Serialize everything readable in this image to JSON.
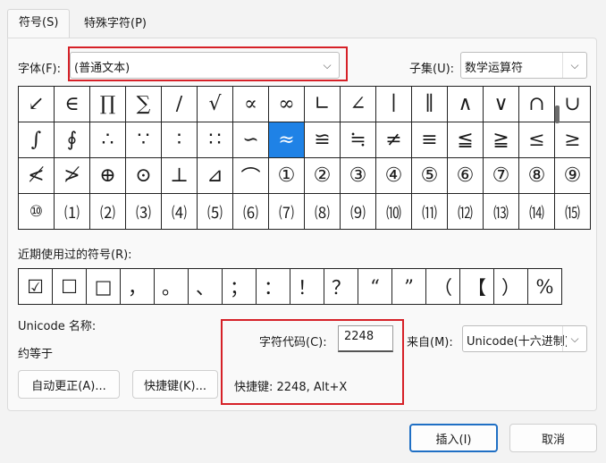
{
  "tabs": [
    {
      "label": "符号(S)"
    },
    {
      "label": "特殊字符(P)"
    }
  ],
  "font": {
    "label": "字体(F):",
    "value": "(普通文本)"
  },
  "subset": {
    "label": "子集(U):",
    "value": "数学运算符"
  },
  "symbols": [
    [
      "↙",
      "∈",
      "∏",
      "∑",
      "∕",
      "√",
      "∝",
      "∞",
      "∟",
      "∠",
      "∣",
      "∥",
      "∧",
      "∨",
      "∩",
      "∪"
    ],
    [
      "∫",
      "∮",
      "∴",
      "∵",
      "∶",
      "∷",
      "∽",
      "≈",
      "≌",
      "≒",
      "≠",
      "≡",
      "≦",
      "≧",
      "≤",
      "≥"
    ],
    [
      "≮",
      "≯",
      "⊕",
      "⊙",
      "⊥",
      "⊿",
      "⌒",
      "①",
      "②",
      "③",
      "④",
      "⑤",
      "⑥",
      "⑦",
      "⑧",
      "⑨"
    ],
    [
      "⑩",
      "⑴",
      "⑵",
      "⑶",
      "⑷",
      "⑸",
      "⑹",
      "⑺",
      "⑻",
      "⑼",
      "⑽",
      "⑾",
      "⑿",
      "⒀",
      "⒁",
      "⒂"
    ]
  ],
  "selected_symbol": "≈",
  "recent_label": "近期使用过的符号(R):",
  "recent": [
    "☑",
    "☐",
    "□",
    "，",
    "。",
    "、",
    "；",
    "：",
    "！",
    "？",
    "“",
    "”",
    "（",
    "【",
    "）",
    "%"
  ],
  "unicode_name_label": "Unicode 名称:",
  "unicode_name": "约等于",
  "char_code_label": "字符代码(C):",
  "char_code": "2248",
  "from_label": "来自(M):",
  "from_value": "Unicode(十六进制)",
  "shortcut_info": "快捷键: 2248, Alt+X",
  "buttons": {
    "autocorrect": "自动更正(A)...",
    "shortcut_key": "快捷键(K)...",
    "insert": "插入(I)",
    "cancel": "取消"
  },
  "colors": {
    "selection": "#1f82e6",
    "highlight": "#d62128"
  }
}
